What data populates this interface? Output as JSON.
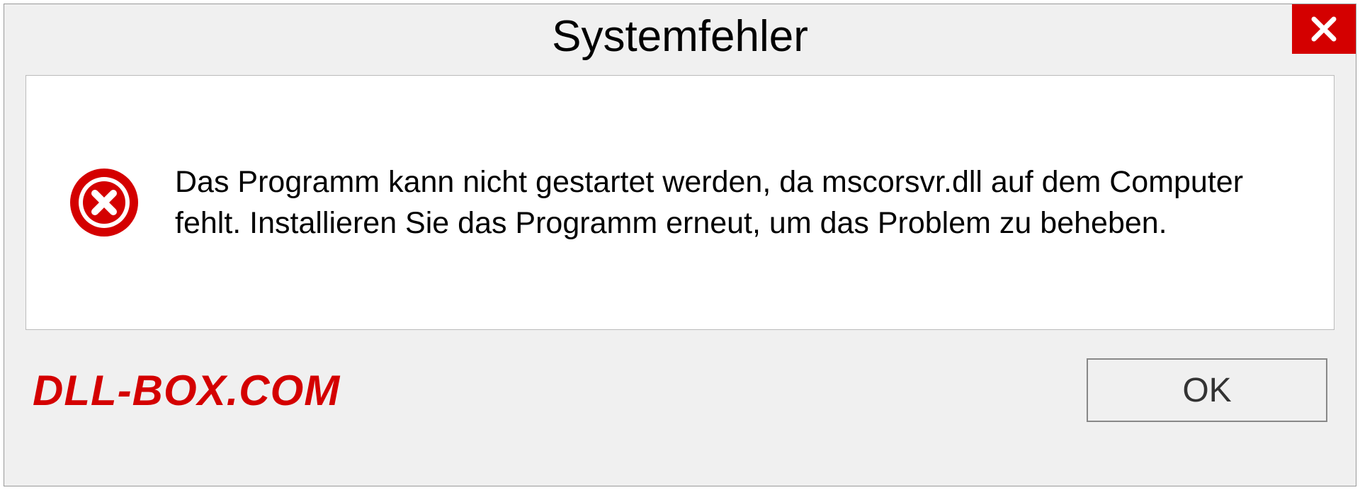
{
  "dialog": {
    "title": "Systemfehler",
    "message": "Das Programm kann nicht gestartet werden, da mscorsvr.dll auf dem Computer fehlt. Installieren Sie das Programm erneut, um das Problem zu beheben.",
    "ok_label": "OK"
  },
  "watermark": "DLL-BOX.COM"
}
